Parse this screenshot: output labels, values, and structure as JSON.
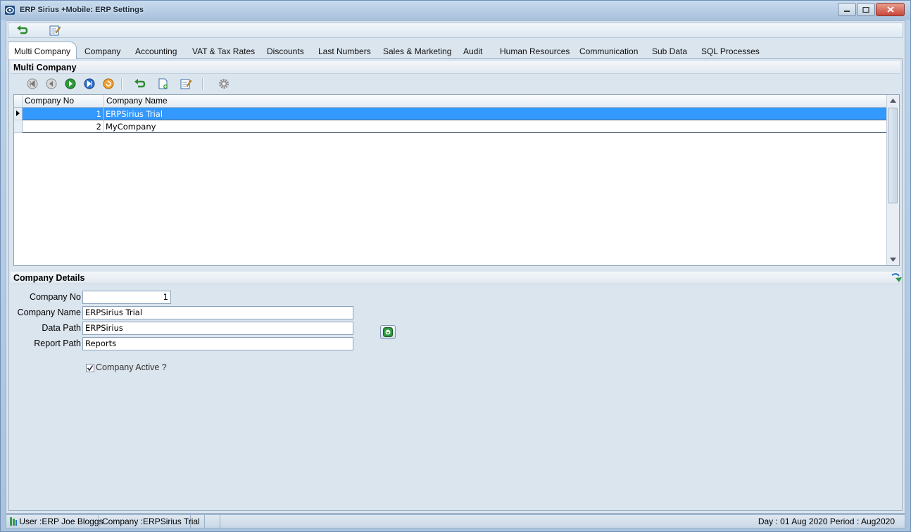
{
  "window": {
    "title": "ERP Sirius +Mobile: ERP Settings",
    "icons": {
      "app": "app-logo-icon",
      "minimize": "minimize-icon",
      "maximize": "maximize-icon",
      "close": "close-icon"
    }
  },
  "top_toolbar": {
    "icons": [
      "undo-icon",
      "edit-note-icon"
    ]
  },
  "tabs": [
    {
      "label": "Multi Company",
      "active": true
    },
    {
      "label": "Company"
    },
    {
      "label": "Accounting"
    },
    {
      "label": "VAT & Tax Rates"
    },
    {
      "label": "Discounts"
    },
    {
      "label": "Last Numbers"
    },
    {
      "label": "Sales & Marketing"
    },
    {
      "label": "Audit"
    },
    {
      "label": "Human Resources"
    },
    {
      "label": "Communication"
    },
    {
      "label": "Sub Data"
    },
    {
      "label": "SQL Processes"
    }
  ],
  "multi_company": {
    "header": "Multi Company",
    "toolbar_icons": [
      "first-record-icon",
      "previous-record-icon",
      "next-record-icon",
      "last-record-icon",
      "refresh-icon",
      "undo-icon",
      "new-document-icon",
      "edit-note-icon",
      "settings-gear-icon"
    ],
    "grid": {
      "columns": [
        "Company No",
        "Company Name"
      ],
      "rows": [
        {
          "no": "1",
          "name": "ERPSirius Trial",
          "selected": true
        },
        {
          "no": "2",
          "name": "MyCompany"
        }
      ]
    }
  },
  "company_details": {
    "header": "Company Details",
    "collapse_icon": "collapse-arrow-icon",
    "fields": {
      "company_no": {
        "label": "Company No",
        "value": "1"
      },
      "company_name": {
        "label": "Company Name",
        "value": "ERPSirius Trial"
      },
      "data_path": {
        "label": "Data Path",
        "value": "ERPSirius"
      },
      "report_path": {
        "label": "Report Path",
        "value": "Reports"
      }
    },
    "browse_icon": "browse-folder-icon",
    "company_active": {
      "label": "Company Active ?",
      "checked": true
    }
  },
  "status_bar": {
    "user": "User :ERP Joe Bloggs",
    "company": "Company :ERPSirius Trial",
    "day_period": "Day : 01 Aug 2020  Period : Aug2020"
  },
  "colors": {
    "selection": "#3399ff",
    "panel": "#dbe5ee",
    "frame": "#aac4de"
  }
}
